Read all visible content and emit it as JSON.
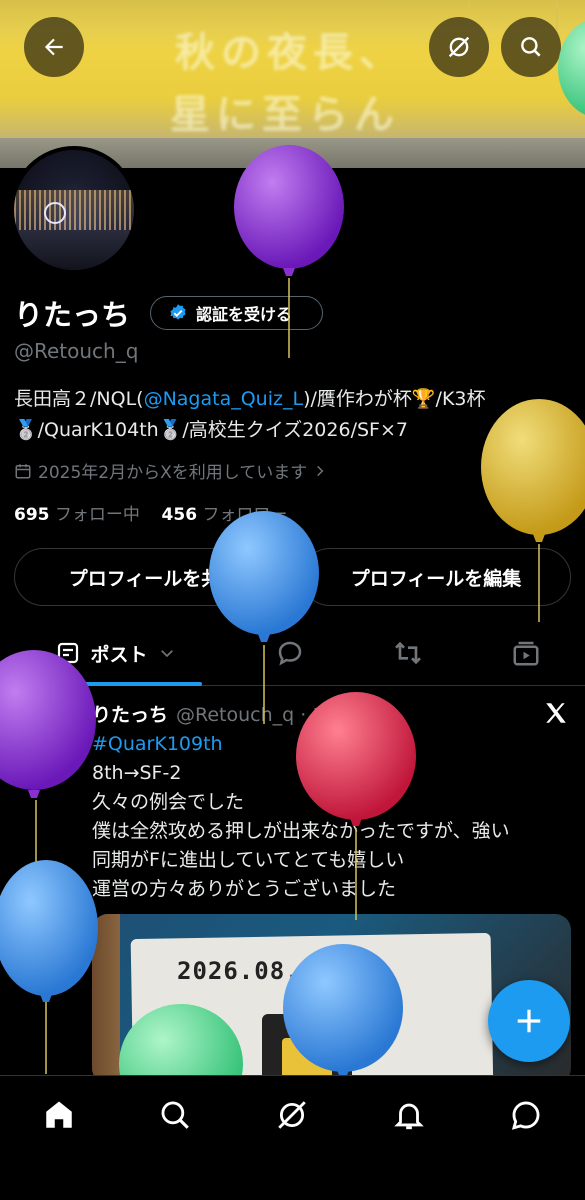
{
  "banner": {
    "overlay_line1": "秋の夜長、",
    "overlay_line2": "星に至らん"
  },
  "header": {
    "back_icon": "arrow-left-icon",
    "grok_icon": "grok-icon",
    "search_icon": "search-icon"
  },
  "profile": {
    "name": "りたっち",
    "verify_label": "認証を受ける",
    "handle": "@Retouch_q",
    "bio": {
      "part1": "長田高２/NQL(",
      "mention": "@Nagata_Quiz_L",
      "part2": ")/贋作わが杯🏆/K3杯",
      "part3": "🥈/QuarK104th🥈/高校生クイズ2026/SF×7"
    },
    "joined": "2025年2月からXを利用しています",
    "following_count": "695",
    "following_label": "フォロー中",
    "followers_count": "456",
    "followers_label": "フォロワー",
    "share_button": "プロフィールを共有",
    "edit_button": "プロフィールを編集"
  },
  "tabs": {
    "posts_label": "ポスト"
  },
  "post": {
    "name": "りたっち",
    "handle": "@Retouch_q · 1日",
    "hashtag": "#QuarK109th",
    "lines": [
      "8th→SF-2",
      "久々の例会でした",
      "僕は全然攻める押しが出来なかったですが、強い",
      "同期がFに進出していてとても嬉しい",
      "運営の方々ありがとうございました"
    ],
    "image_text": "2026.08.10"
  },
  "colors": {
    "accent": "#1d9bf0",
    "muted": "#71767b",
    "background": "#000000"
  },
  "balloons": [
    "purple",
    "yellow",
    "blue",
    "red",
    "purple",
    "blue",
    "green",
    "blue",
    "green"
  ]
}
